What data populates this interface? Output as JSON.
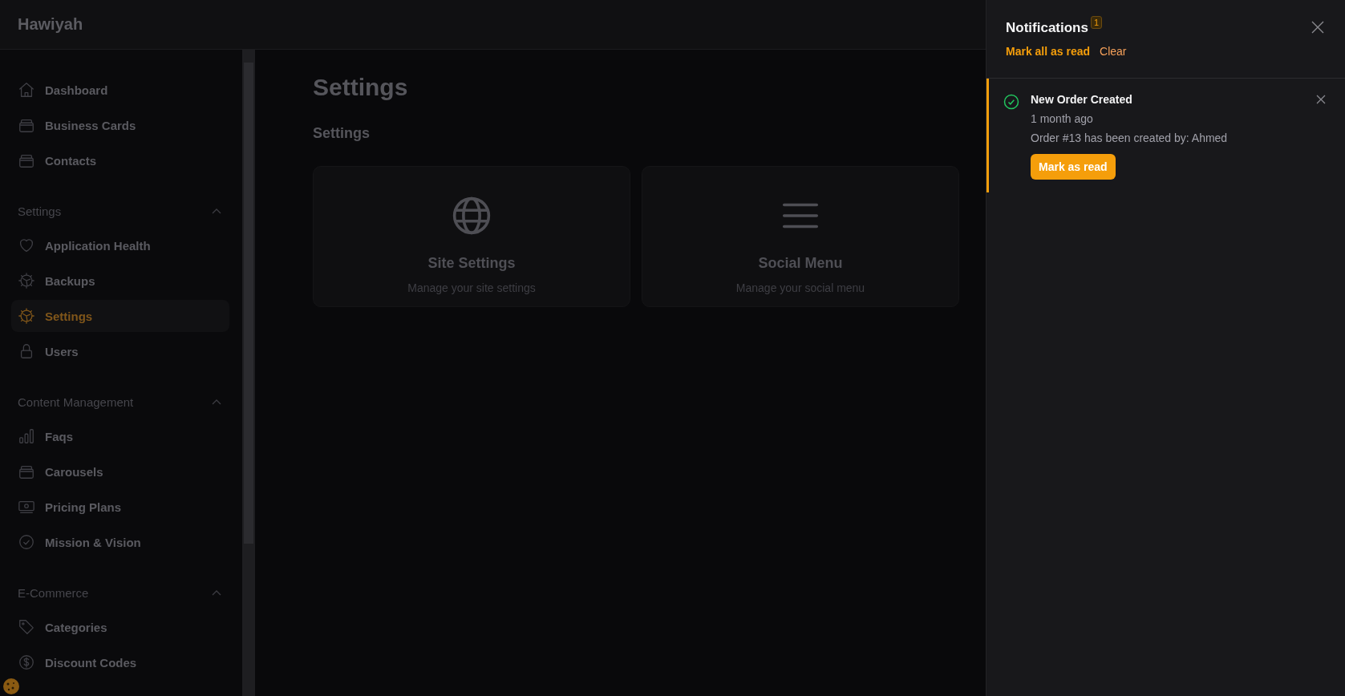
{
  "brand": "Hawiyah",
  "sidebar": {
    "groups": [
      {
        "items": [
          {
            "label": "Dashboard",
            "kind": "home",
            "selected": false
          },
          {
            "label": "Business Cards",
            "kind": "stack",
            "selected": false
          },
          {
            "label": "Contacts",
            "kind": "stack",
            "selected": false
          }
        ]
      },
      {
        "heading": "Settings",
        "expanded": true,
        "items": [
          {
            "label": "Application Health",
            "kind": "heart",
            "selected": false
          },
          {
            "label": "Backups",
            "kind": "gear",
            "selected": false
          },
          {
            "label": "Settings",
            "kind": "gear",
            "selected": true
          },
          {
            "label": "Users",
            "kind": "lock",
            "selected": false
          }
        ]
      },
      {
        "heading": "Content Management",
        "expanded": true,
        "items": [
          {
            "label": "Faqs",
            "kind": "bars",
            "selected": false
          },
          {
            "label": "Carousels",
            "kind": "stack",
            "selected": false
          },
          {
            "label": "Pricing Plans",
            "kind": "cash",
            "selected": false
          },
          {
            "label": "Mission & Vision",
            "kind": "badge",
            "selected": false
          }
        ]
      },
      {
        "heading": "E-Commerce",
        "expanded": true,
        "items": [
          {
            "label": "Categories",
            "kind": "tag",
            "selected": false
          },
          {
            "label": "Discount Codes",
            "kind": "dollar",
            "selected": false
          }
        ]
      }
    ]
  },
  "main": {
    "title": "Settings",
    "section": "Settings",
    "cards": [
      {
        "kind": "globe",
        "title": "Site Settings",
        "description": "Manage your site settings"
      },
      {
        "kind": "menu",
        "title": "Social Menu",
        "description": "Manage your social menu"
      }
    ]
  },
  "notifications": {
    "title": "Notifications",
    "count": "1",
    "actions": [
      "Mark all as read",
      "Clear"
    ],
    "items": [
      {
        "title": "New Order Created",
        "time": "1 month ago",
        "body": "Order #13 has been created by: Ahmed",
        "button": "Mark as read",
        "read": false
      }
    ]
  }
}
